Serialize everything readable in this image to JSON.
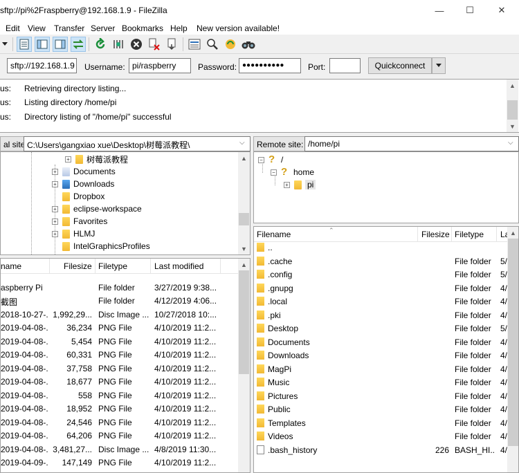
{
  "window": {
    "title": "sftp://pi%2Fraspberry@192.168.1.9 - FileZilla",
    "minimize": "—",
    "maximize": "☐",
    "close": "✕"
  },
  "menu": [
    "Edit",
    "View",
    "Transfer",
    "Server",
    "Bookmarks",
    "Help",
    "New version available!"
  ],
  "quickconnect": {
    "host_value": "sftp://192.168.1.9",
    "username_label": "Username:",
    "username_value": "pi/raspberry",
    "password_label": "Password:",
    "password_value": "●●●●●●●●●●",
    "port_label": "Port:",
    "port_value": "",
    "button": "Quickconnect"
  },
  "log": [
    {
      "k": "us:",
      "v": "Retrieving directory listing..."
    },
    {
      "k": "us:",
      "v": "Listing directory /home/pi"
    },
    {
      "k": "us:",
      "v": "Directory listing of \"/home/pi\" successful"
    }
  ],
  "local": {
    "label": "al site:",
    "path": "C:\\Users\\gangxiao xue\\Desktop\\树莓派教程\\",
    "tree": [
      "树莓派教程",
      "Documents",
      "Downloads",
      "Dropbox",
      "eclipse-workspace",
      "Favorites",
      "HLMJ",
      "IntelGraphicsProfiles"
    ],
    "columns": [
      "name",
      "Filesize",
      "Filetype",
      "Last modified"
    ],
    "files": [
      {
        "name": "",
        "size": "",
        "type": "",
        "modified": ""
      },
      {
        "name": "aspberry Pi",
        "size": "",
        "type": "File folder",
        "modified": "3/27/2019 9:38..."
      },
      {
        "name": "截图",
        "size": "",
        "type": "File folder",
        "modified": "4/12/2019 4:06..."
      },
      {
        "name": "2018-10-27-...",
        "size": "1,992,29...",
        "type": "Disc Image ...",
        "modified": "10/27/2018 10:..."
      },
      {
        "name": "2019-04-08-...",
        "size": "36,234",
        "type": "PNG File",
        "modified": "4/10/2019 11:2..."
      },
      {
        "name": "2019-04-08-...",
        "size": "5,454",
        "type": "PNG File",
        "modified": "4/10/2019 11:2..."
      },
      {
        "name": "2019-04-08-...",
        "size": "60,331",
        "type": "PNG File",
        "modified": "4/10/2019 11:2..."
      },
      {
        "name": "2019-04-08-...",
        "size": "37,758",
        "type": "PNG File",
        "modified": "4/10/2019 11:2..."
      },
      {
        "name": "2019-04-08-...",
        "size": "18,677",
        "type": "PNG File",
        "modified": "4/10/2019 11:2..."
      },
      {
        "name": "2019-04-08-...",
        "size": "558",
        "type": "PNG File",
        "modified": "4/10/2019 11:2..."
      },
      {
        "name": "2019-04-08-...",
        "size": "18,952",
        "type": "PNG File",
        "modified": "4/10/2019 11:2..."
      },
      {
        "name": "2019-04-08-...",
        "size": "24,546",
        "type": "PNG File",
        "modified": "4/10/2019 11:2..."
      },
      {
        "name": "2019-04-08-...",
        "size": "64,206",
        "type": "PNG File",
        "modified": "4/10/2019 11:2..."
      },
      {
        "name": "2019-04-08-...",
        "size": "3,481,27...",
        "type": "Disc Image ...",
        "modified": "4/8/2019 11:30..."
      },
      {
        "name": "2019-04-09-...",
        "size": "147,149",
        "type": "PNG File",
        "modified": "4/10/2019 11:2..."
      }
    ]
  },
  "remote": {
    "label": "Remote site:",
    "path": "/home/pi",
    "tree": [
      "/",
      "home",
      "pi"
    ],
    "columns": [
      "Filename",
      "Filesize",
      "Filetype",
      "La"
    ],
    "files": [
      {
        "name": "..",
        "size": "",
        "type": "",
        "mod": ""
      },
      {
        "name": ".cache",
        "size": "",
        "type": "File folder",
        "mod": "5/"
      },
      {
        "name": ".config",
        "size": "",
        "type": "File folder",
        "mod": "5/"
      },
      {
        "name": ".gnupg",
        "size": "",
        "type": "File folder",
        "mod": "4/"
      },
      {
        "name": ".local",
        "size": "",
        "type": "File folder",
        "mod": "4/"
      },
      {
        "name": ".pki",
        "size": "",
        "type": "File folder",
        "mod": "4/"
      },
      {
        "name": "Desktop",
        "size": "",
        "type": "File folder",
        "mod": "5/"
      },
      {
        "name": "Documents",
        "size": "",
        "type": "File folder",
        "mod": "4/"
      },
      {
        "name": "Downloads",
        "size": "",
        "type": "File folder",
        "mod": "4/"
      },
      {
        "name": "MagPi",
        "size": "",
        "type": "File folder",
        "mod": "4/"
      },
      {
        "name": "Music",
        "size": "",
        "type": "File folder",
        "mod": "4/"
      },
      {
        "name": "Pictures",
        "size": "",
        "type": "File folder",
        "mod": "4/"
      },
      {
        "name": "Public",
        "size": "",
        "type": "File folder",
        "mod": "4/"
      },
      {
        "name": "Templates",
        "size": "",
        "type": "File folder",
        "mod": "4/"
      },
      {
        "name": "Videos",
        "size": "",
        "type": "File folder",
        "mod": "4/"
      },
      {
        "name": ".bash_history",
        "size": "226",
        "type": "BASH_HI...",
        "mod": "4/"
      }
    ]
  }
}
